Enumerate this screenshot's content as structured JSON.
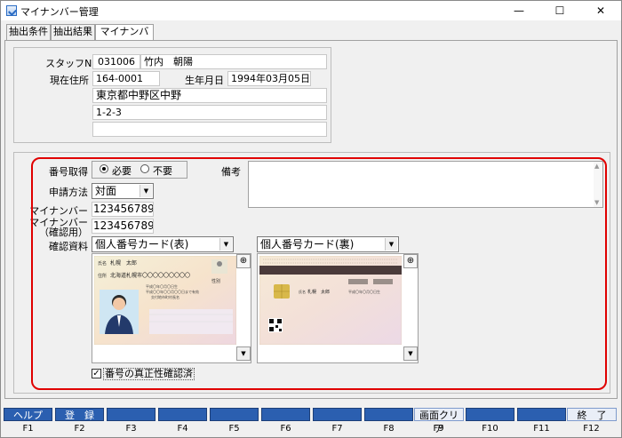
{
  "window": {
    "title": "マイナンバー管理",
    "minimize": "—",
    "maximize": "☐",
    "close": "✕"
  },
  "tabs": [
    {
      "label": "抽出条件"
    },
    {
      "label": "抽出結果"
    },
    {
      "label": "マイナンバー"
    }
  ],
  "staff": {
    "staff_no_label": "スタッフNO",
    "staff_no": "031006",
    "name": "竹内　朝陽",
    "address_label": "現在住所",
    "postal_code": "164-0001",
    "birth_label": "生年月日",
    "birth_date": "1994年03月05日",
    "address_line1": "東京都中野区中野",
    "address_line2": "1-2-3",
    "address_line3": ""
  },
  "mynumber": {
    "acquire_label": "番号取得",
    "acquire_options": [
      {
        "label": "必要",
        "checked": true
      },
      {
        "label": "不要",
        "checked": false
      }
    ],
    "remarks_label": "備考",
    "remarks": "",
    "method_label": "申請方法",
    "method_value": "対面",
    "number_label": "マイナンバー",
    "number": "123456789012",
    "confirm_label_line1": "マイナンバー",
    "confirm_label_line2": "（確認用）",
    "number_confirm": "123456789012",
    "document_label": "確認資料",
    "front_doc": "個人番号カード(表)",
    "back_doc": "個人番号カード(裏)",
    "verified_checked": true,
    "verified_label": "番号の真正性確認済"
  },
  "card_front": {
    "name_prefix": "氏名",
    "name": "札幌　太郎",
    "address_prefix": "住所",
    "address": "北海道札幌市〇〇〇〇〇〇〇〇〇",
    "sex": "性別",
    "date1": "平成〇年〇月〇日生",
    "date2": "平成〇〇年〇〇月〇〇日まで有効",
    "issuer": "交付地市町村長名"
  },
  "card_back": {
    "name_prefix": "氏名",
    "name": "札幌　太郎",
    "date": "平成〇年〇月〇日生"
  },
  "fkeys": [
    {
      "label": "ヘルプ",
      "num": "F1"
    },
    {
      "label": "登　録",
      "num": "F2"
    },
    {
      "label": "",
      "num": "F3"
    },
    {
      "label": "",
      "num": "F4"
    },
    {
      "label": "",
      "num": "F5"
    },
    {
      "label": "",
      "num": "F6"
    },
    {
      "label": "",
      "num": "F7"
    },
    {
      "label": "",
      "num": "F8"
    },
    {
      "label": "画面クリア",
      "num": "F9"
    },
    {
      "label": "",
      "num": "F10"
    },
    {
      "label": "",
      "num": "F11"
    },
    {
      "label": "終　了",
      "num": "F12"
    }
  ],
  "colors": {
    "fkey_active": "#2b5fb0",
    "highlight": "#e00000"
  }
}
